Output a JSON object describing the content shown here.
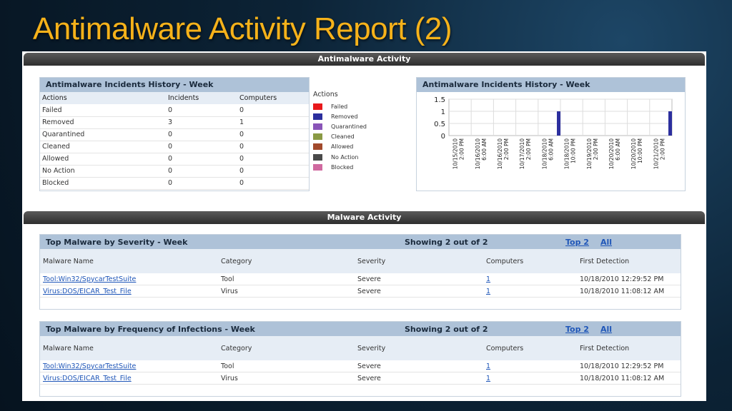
{
  "slide": {
    "title": "Antimalware Activity Report (2)"
  },
  "antimalware_bar": "Antimalware Activity",
  "malware_bar": "Malware Activity",
  "incidents_table": {
    "title": "Antimalware Incidents History - Week",
    "headers": [
      "Actions",
      "Incidents",
      "Computers"
    ],
    "rows": [
      [
        "Failed",
        "0",
        "0"
      ],
      [
        "Removed",
        "3",
        "1"
      ],
      [
        "Quarantined",
        "0",
        "0"
      ],
      [
        "Cleaned",
        "0",
        "0"
      ],
      [
        "Allowed",
        "0",
        "0"
      ],
      [
        "No Action",
        "0",
        "0"
      ],
      [
        "Blocked",
        "0",
        "0"
      ]
    ]
  },
  "legend": {
    "title": "Actions",
    "items": [
      {
        "label": "Failed",
        "color": "#e8191c"
      },
      {
        "label": "Removed",
        "color": "#2c2f9e"
      },
      {
        "label": "Quarantined",
        "color": "#8a55b8"
      },
      {
        "label": "Cleaned",
        "color": "#8a9a44"
      },
      {
        "label": "Allowed",
        "color": "#a24a2c"
      },
      {
        "label": "No Action",
        "color": "#4a4a4a"
      },
      {
        "label": "Blocked",
        "color": "#d06aa0"
      }
    ]
  },
  "chart_data": {
    "type": "bar",
    "title": "Antimalware Incidents History - Week",
    "categories": [
      "10/15/2010 2:00 PM",
      "10/16/2010 6:00 AM",
      "10/16/2010 2:00 PM",
      "10/17/2010 2:00 PM",
      "10/18/2010 6:00 AM",
      "10/18/2010 10:00 PM",
      "10/19/2010 2:00 PM",
      "10/20/2010 6:00 AM",
      "10/20/2010 10:00 PM",
      "10/21/2010 2:00 PM"
    ],
    "series": [
      {
        "name": "Removed",
        "color": "#2c2f9e",
        "values": [
          0,
          0,
          0,
          0,
          1,
          0,
          0,
          0,
          0,
          1
        ]
      }
    ],
    "yticks": [
      "1.5",
      "1",
      "0.5",
      "0"
    ],
    "ylim": [
      0,
      1.5
    ],
    "grid": true
  },
  "severity_table": {
    "title": "Top Malware by Severity - Week",
    "showing": "Showing 2 out of 2",
    "top2": "Top 2",
    "all": "All",
    "headers": [
      "Malware Name",
      "Category",
      "Severity",
      "Computers",
      "First Detection"
    ],
    "rows": [
      [
        "Tool:Win32/SpycarTestSuite",
        "Tool",
        "Severe",
        "1",
        "10/18/2010 12:29:52 PM"
      ],
      [
        "Virus:DOS/EICAR_Test_File",
        "Virus",
        "Severe",
        "1",
        "10/18/2010 11:08:12 AM"
      ]
    ]
  },
  "frequency_table": {
    "title": "Top Malware by Frequency of Infections - Week",
    "showing": "Showing 2 out of 2",
    "top2": "Top 2",
    "all": "All",
    "headers": [
      "Malware Name",
      "Category",
      "Severity",
      "Computers",
      "First Detection"
    ],
    "rows": [
      [
        "Tool:Win32/SpycarTestSuite",
        "Tool",
        "Severe",
        "1",
        "10/18/2010 12:29:52 PM"
      ],
      [
        "Virus:DOS/EICAR_Test_File",
        "Virus",
        "Severe",
        "1",
        "10/18/2010 11:08:12 AM"
      ]
    ]
  }
}
